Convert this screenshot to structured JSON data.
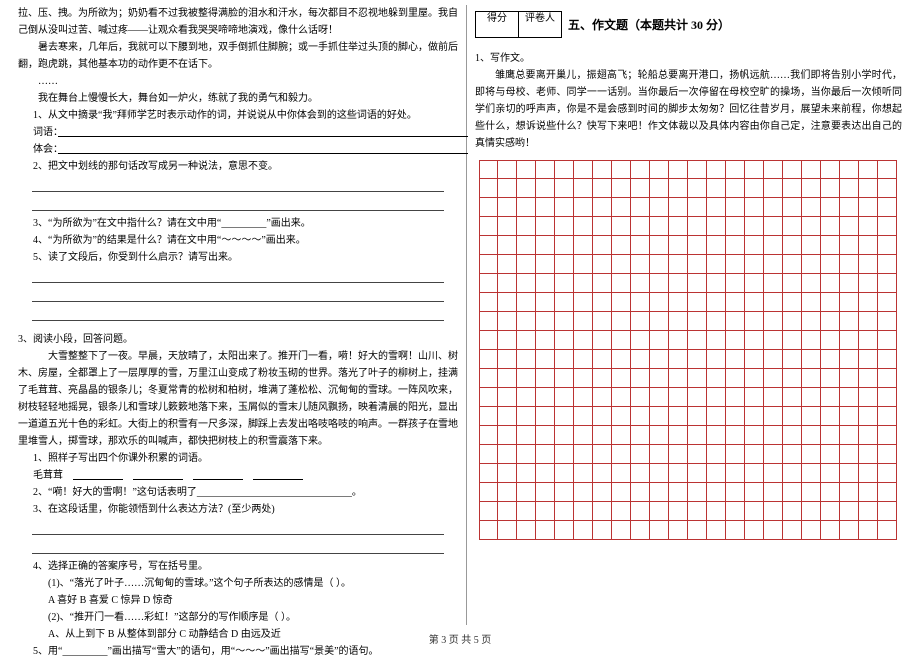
{
  "left": {
    "p1": "拉、压、拽。为所欲为；奶奶看不过我被整得满脸的泪水和汗水，每次都目不忍视地躲到里屋。我自己倒从没叫过苦、喊过疼——让观众看我哭哭啼啼地演戏，像什么话呀！",
    "p2": "暑去寒来，几年后，我就可以下腰到地，双手倒抓住脚腕；或一手抓住举过头顶的脚心，做前后翻，跑虎跳，其他基本功的动作更不在话下。",
    "p3": "……",
    "p4": "我在舞台上慢慢长大，舞台如一炉火，练就了我的勇气和毅力。",
    "q1": "1、从文中摘录“我”拜师学艺时表示动作的词，并说说从中你体会到的这些词语的好处。",
    "q1l1": "词语：",
    "q1l2": "体会：",
    "q2": "2、把文中划线的那句话改写成另一种说法，意思不变。",
    "q3": "3、“为所欲为”在文中指什么？请在文中用“_________”画出来。",
    "q4": "4、“为所欲为”的结果是什么？请在文中用“～～～～”画出来。",
    "q5": "5、读了文段后，你受到什么启示？请写出来。",
    "r_intro": "3、阅读小段，回答问题。",
    "r_p1": "大雪整整下了一夜。早晨，天放晴了，太阳出来了。推开门一看，嗬！好大的雪啊！山川、树木、房屋，全都罩上了一层厚厚的雪，万里江山变成了粉妆玉砌的世界。落光了叶子的柳树上，挂满了毛茸茸、亮晶晶的银条儿；冬夏常青的松树和柏树，堆满了蓬松松、沉甸甸的雪球。一阵风吹来，树枝轻轻地摇晃，银条儿和雪球儿簌簌地落下来，玉屑似的雪末儿随风飘扬，映着清晨的阳光，显出一道道五光十色的彩虹。大街上的积雪有一尺多深，脚踩上去发出咯吱咯吱的响声。一群孩子在雪地里堆雪人，掷雪球，那欢乐的叫喊声，都快把树枝上的积雪震落下来。",
    "rq1": "1、照样子写出四个你课外积累的词语。",
    "rq1l": "毛茸茸",
    "rq2": "2、“嗬！好大的雪啊！”这句话表明了_______________________________。",
    "rq3": "3、在这段话里，你能领悟到什么表达方法？(至少两处)",
    "rq4": "4、选择正确的答案序号，写在括号里。",
    "rq4a": "(1)、“落光了叶子……沉甸甸的雪球。”这个句子所表达的感情是（        ）。",
    "rq4a_opts": "A  喜好        B  喜爱        C  惊异        D  惊奇",
    "rq4b": "(2)、“推开门一看……彩虹！”这部分的写作顺序是（        ）。",
    "rq4b_opts": "A、从上到下     B  从整体到部分     C  动静结合     D  由远及近",
    "rq5": "5、用“_________”画出描写“雪大”的语句，用“～～～”画出描写“景美”的语句。"
  },
  "right": {
    "score_l": "得分",
    "score_r": "评卷人",
    "section": "五、作文题（本题共计 30 分）",
    "w_label": "1、写作文。",
    "w_p": "雏鹰总要离开巢儿，振翅高飞；轮船总要离开港口，扬帆远航……我们即将告别小学时代，即将与母校、老师、同学一一话别。当你最后一次停留在母校空旷的操场，当你最后一次倾听同学们亲切的呼声声，你是不是会感到时间的脚步太匆匆？回忆往昔岁月，展望未来前程，你想起些什么，想诉说些什么？快写下来吧！作文体裁以及具体内容由你自己定，注意要表达出自己的真情实感哟！"
  },
  "footer": "第 3 页  共 5 页",
  "essay": {
    "rows": 20,
    "cols": 22
  }
}
